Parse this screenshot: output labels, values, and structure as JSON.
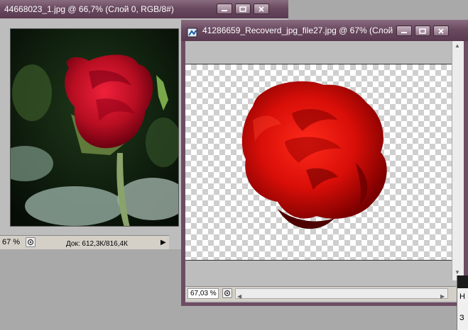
{
  "window1": {
    "title": "44668023_1.jpg @ 66,7% (Слой 0, RGB/8#)",
    "status": {
      "zoom": "67 %",
      "doc_info": "Док: 612,3К/816,4К"
    }
  },
  "window2": {
    "title": "41286659_Recoverd_jpg_file27.jpg @ 67% (Слой",
    "status": {
      "zoom": "67,03 %"
    }
  },
  "dialog_fragment": {
    "letter_1": "Н",
    "letter_2": "З"
  },
  "icons": {
    "minimize": "minimize-icon",
    "maximize": "maximize-icon",
    "close": "close-icon",
    "document": "photoshop-doc-icon",
    "status_menu": "status-menu-icon"
  },
  "colors": {
    "titlebar": "#6a4a60",
    "rose": "#d01010",
    "workspace": "#a9a9a9"
  }
}
